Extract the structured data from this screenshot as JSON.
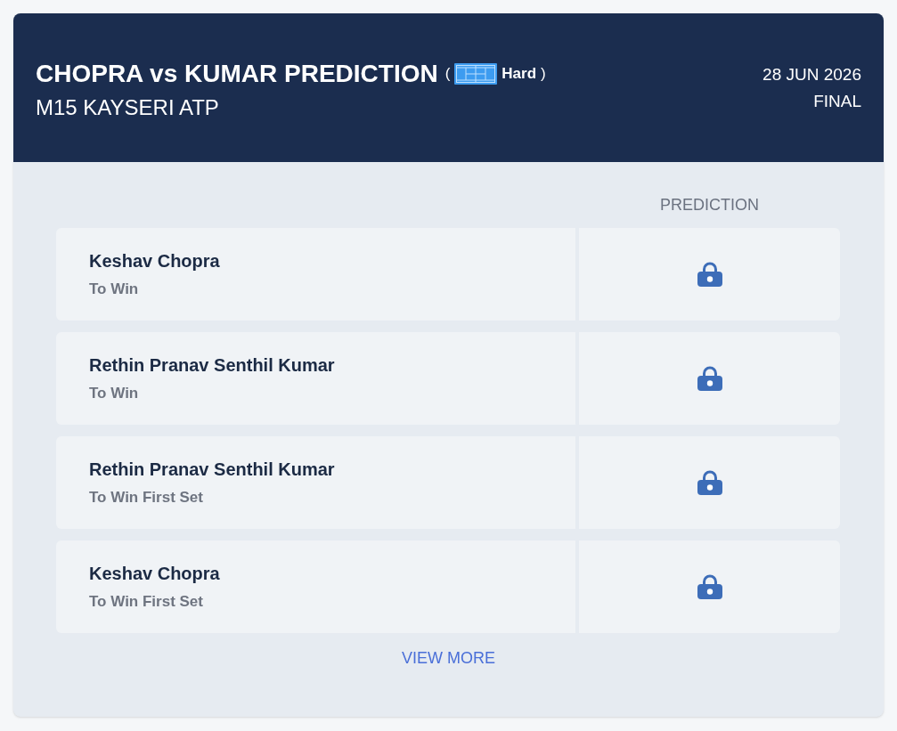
{
  "header": {
    "title": "CHOPRA vs KUMAR PREDICTION",
    "paren_open": "(",
    "surface": "Hard",
    "paren_close": ")",
    "tournament": "M15 KAYSERI ATP",
    "date": "28 JUN 2026",
    "status": "FINAL"
  },
  "table": {
    "columns": [
      "PREDICTION"
    ],
    "rows": [
      {
        "player": "Keshav Chopra",
        "market": "To Win",
        "locked": true
      },
      {
        "player": "Rethin Pranav Senthil Kumar",
        "market": "To Win",
        "locked": true
      },
      {
        "player": "Rethin Pranav Senthil Kumar",
        "market": "To Win First Set",
        "locked": true
      },
      {
        "player": "Keshav Chopra",
        "market": "To Win First Set",
        "locked": true
      }
    ]
  },
  "view_more": "VIEW MORE"
}
